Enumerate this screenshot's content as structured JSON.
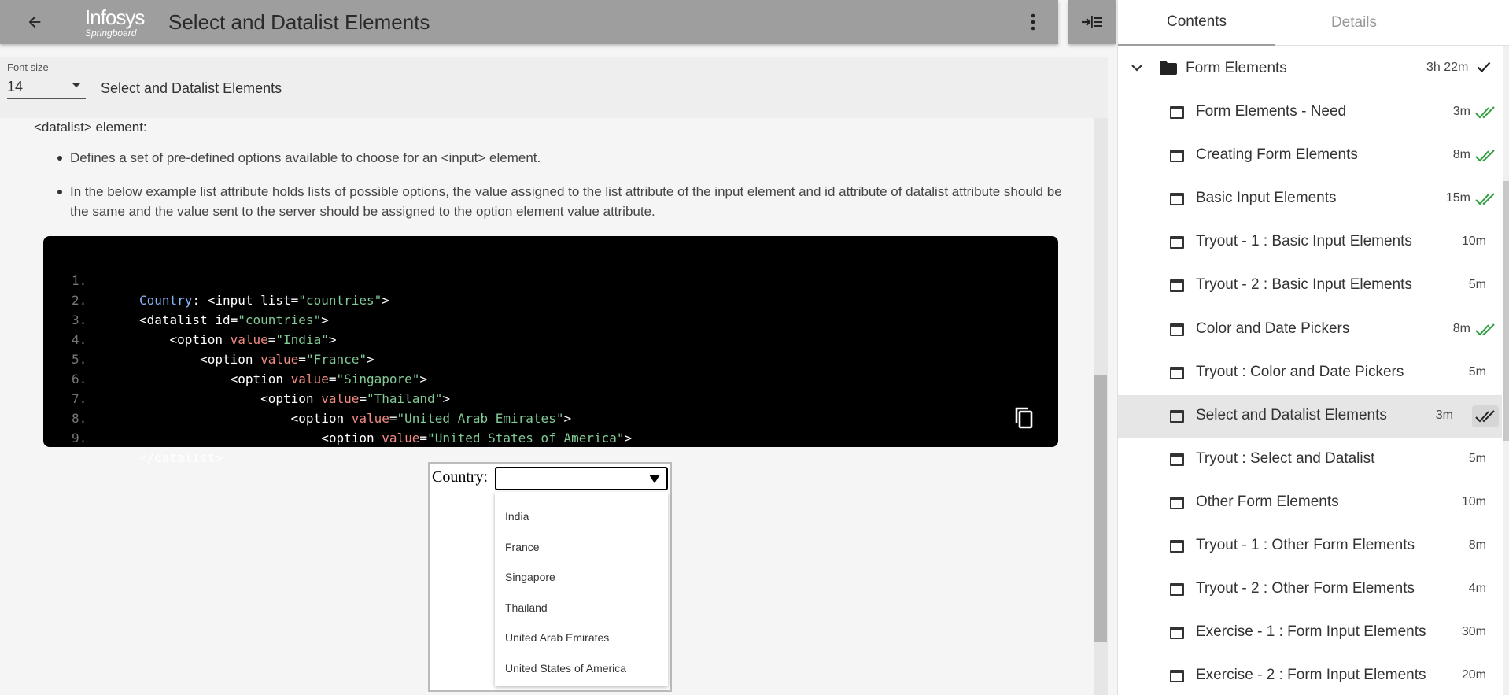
{
  "header": {
    "title": "Select and Datalist Elements",
    "logo_line1": "Infosys",
    "logo_line2": "Springboard"
  },
  "font_bar": {
    "label": "Font size",
    "value": "14",
    "topic": "Select and Datalist Elements"
  },
  "content": {
    "datalist_heading": "<datalist> element:",
    "bullets": [
      "Defines a set of pre-defined options available to choose for an <input> element.",
      "In the below example list attribute holds lists of possible options, the value assigned to the list attribute of the input element and id attribute of datalist attribute should be the same and the value sent to the server should be assigned to the option element value attribute."
    ],
    "code_lines": [
      "1.",
      "2.",
      "3.",
      "4.",
      "5.",
      "6.",
      "7.",
      "8.",
      "9."
    ],
    "code": {
      "l1_a": "Country",
      "l1_b": ": <input list=",
      "l1_c": "\"countries\"",
      "l1_d": ">",
      "l2_a": "<datalist id=",
      "l2_b": "\"countries\"",
      "l2_c": ">",
      "l3_a": "    <option ",
      "l3_b": "value",
      "l3_c": "=",
      "l3_d": "\"India\"",
      "l3_e": ">",
      "l4_a": "        <option ",
      "l4_b": "value",
      "l4_c": "=",
      "l4_d": "\"France\"",
      "l4_e": ">",
      "l5_a": "            <option ",
      "l5_b": "value",
      "l5_c": "=",
      "l5_d": "\"Singapore\"",
      "l5_e": ">",
      "l6_a": "                <option ",
      "l6_b": "value",
      "l6_c": "=",
      "l6_d": "\"Thailand\"",
      "l6_e": ">",
      "l7_a": "                    <option ",
      "l7_b": "value",
      "l7_c": "=",
      "l7_d": "\"United Arab Emirates\"",
      "l7_e": ">",
      "l8_a": "                        <option ",
      "l8_b": "value",
      "l8_c": "=",
      "l8_d": "\"United States of America\"",
      "l8_e": ">",
      "l9_a": "</datalist>"
    },
    "demo": {
      "label": "Country:",
      "input_value": "",
      "options": [
        "India",
        "France",
        "Singapore",
        "Thailand",
        "United Arab Emirates",
        "United States of America"
      ]
    }
  },
  "right_panel": {
    "tabs": [
      "Contents",
      "Details"
    ],
    "section": {
      "title": "Form Elements",
      "duration": "3h 22m"
    },
    "items": [
      {
        "name": "Form Elements - Need",
        "duration": "3m",
        "status": "done"
      },
      {
        "name": "Creating Form Elements",
        "duration": "8m",
        "status": "done"
      },
      {
        "name": "Basic Input Elements",
        "duration": "15m",
        "status": "done"
      },
      {
        "name": "Tryout - 1 : Basic Input Elements",
        "duration": "10m",
        "status": "none"
      },
      {
        "name": "Tryout - 2 : Basic Input Elements",
        "duration": "5m",
        "status": "none"
      },
      {
        "name": "Color and Date Pickers",
        "duration": "8m",
        "status": "done"
      },
      {
        "name": "Tryout : Color and Date Pickers",
        "duration": "5m",
        "status": "none"
      },
      {
        "name": "Select and Datalist Elements",
        "duration": "3m",
        "status": "active"
      },
      {
        "name": "Tryout : Select and Datalist",
        "duration": "5m",
        "status": "none"
      },
      {
        "name": "Other Form Elements",
        "duration": "10m",
        "status": "none"
      },
      {
        "name": "Tryout - 1 : Other Form Elements",
        "duration": "8m",
        "status": "none"
      },
      {
        "name": "Tryout - 2 : Other Form Elements",
        "duration": "4m",
        "status": "none"
      },
      {
        "name": "Exercise - 1 : Form Input Elements",
        "duration": "30m",
        "status": "none"
      },
      {
        "name": "Exercise - 2 : Form Input Elements",
        "duration": "20m",
        "status": "none"
      }
    ]
  },
  "colors": {
    "header_bg": "#9e9e9e",
    "done_check": "#2e9e3e",
    "code_key": "#8ab4f8",
    "code_attr": "#f28b82",
    "code_string": "#81c995"
  }
}
